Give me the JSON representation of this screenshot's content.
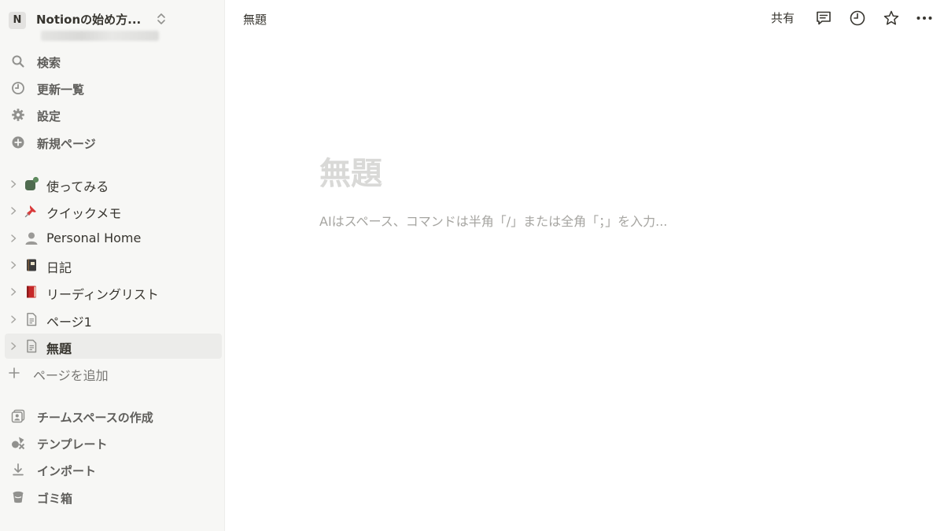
{
  "workspace": {
    "initial": "N",
    "name": "Notionの始め方..."
  },
  "nav": [
    {
      "label": "検索",
      "icon": "search-icon"
    },
    {
      "label": "更新一覧",
      "icon": "clock-icon"
    },
    {
      "label": "設定",
      "icon": "gear-icon"
    },
    {
      "label": "新規ページ",
      "icon": "plus-circle-icon"
    }
  ],
  "pages": [
    {
      "label": "使ってみる",
      "icon": "green-bubbles-icon"
    },
    {
      "label": "クイックメモ",
      "icon": "pushpin-icon",
      "glyph": "📌"
    },
    {
      "label": "Personal Home",
      "icon": "person-icon"
    },
    {
      "label": "日記",
      "icon": "notebook-icon"
    },
    {
      "label": "リーディングリスト",
      "icon": "red-book-icon"
    },
    {
      "label": "ページ1",
      "icon": "document-icon"
    },
    {
      "label": "無題",
      "icon": "document-icon",
      "active": true
    }
  ],
  "add_page": {
    "label": "ページを追加"
  },
  "footer_nav": [
    {
      "label": "チームスペースの作成",
      "icon": "teamspace-icon"
    },
    {
      "label": "テンプレート",
      "icon": "shapes-icon"
    },
    {
      "label": "インポート",
      "icon": "download-icon"
    },
    {
      "label": "ゴミ箱",
      "icon": "trash-icon"
    }
  ],
  "topbar": {
    "title": "無題",
    "share_label": "共有",
    "icons": [
      "comment-icon",
      "history-clock-icon",
      "star-icon",
      "more-icon"
    ]
  },
  "editor": {
    "title": "無題",
    "placeholder": "AIはスペース、コマンドは半角「/」または全角「；」を入力..."
  },
  "colors": {
    "sidebar_bg": "#f7f7f5",
    "active_bg": "#ececea",
    "text": "#37352f",
    "muted": "#787774",
    "placeholder": "#a6a5a1",
    "title_placeholder": "#d9d9d7"
  }
}
